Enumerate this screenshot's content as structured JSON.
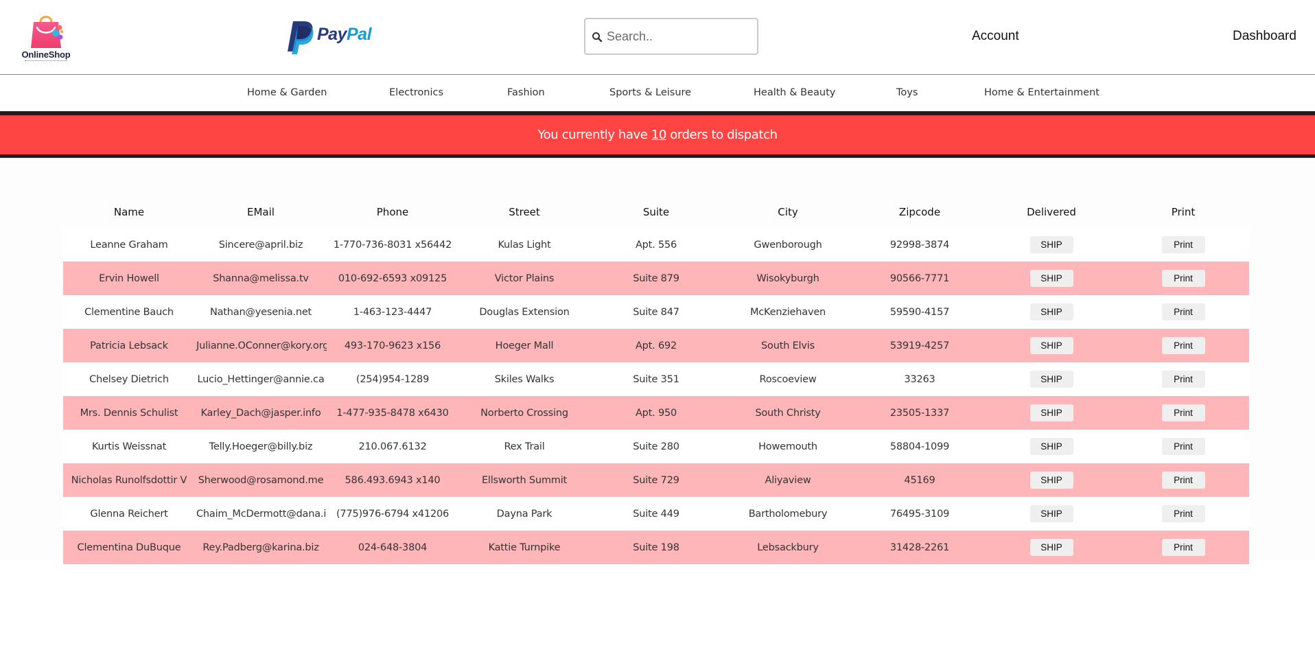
{
  "header": {
    "logo_text": "OnlineShop",
    "paypal_pay": "Pay",
    "paypal_pal": "Pal",
    "search_placeholder": "Search..",
    "account_label": "Account",
    "dashboard_label": "Dashboard"
  },
  "categories": [
    {
      "label": "Home & Garden"
    },
    {
      "label": "Electronics"
    },
    {
      "label": "Fashion"
    },
    {
      "label": "Sports & Leisure"
    },
    {
      "label": "Health & Beauty"
    },
    {
      "label": "Toys"
    },
    {
      "label": "Home & Entertainment"
    }
  ],
  "banner": {
    "prefix": "You currently have ",
    "count": "10",
    "suffix": " orders to dispatch"
  },
  "table": {
    "columns": [
      "Name",
      "EMail",
      "Phone",
      "Street",
      "Suite",
      "City",
      "Zipcode",
      "Delivered",
      "Print"
    ],
    "ship_label": "SHIP",
    "print_label": "Print",
    "rows": [
      {
        "name": "Leanne Graham",
        "email": "Sincere@april.biz",
        "phone": "1-770-736-8031 x56442",
        "street": "Kulas Light",
        "suite": "Apt. 556",
        "city": "Gwenborough",
        "zipcode": "92998-3874"
      },
      {
        "name": "Ervin Howell",
        "email": "Shanna@melissa.tv",
        "phone": "010-692-6593 x09125",
        "street": "Victor Plains",
        "suite": "Suite 879",
        "city": "Wisokyburgh",
        "zipcode": "90566-7771"
      },
      {
        "name": "Clementine Bauch",
        "email": "Nathan@yesenia.net",
        "phone": "1-463-123-4447",
        "street": "Douglas Extension",
        "suite": "Suite 847",
        "city": "McKenziehaven",
        "zipcode": "59590-4157"
      },
      {
        "name": "Patricia Lebsack",
        "email": "Julianne.OConner@kory.org",
        "phone": "493-170-9623 x156",
        "street": "Hoeger Mall",
        "suite": "Apt. 692",
        "city": "South Elvis",
        "zipcode": "53919-4257"
      },
      {
        "name": "Chelsey Dietrich",
        "email": "Lucio_Hettinger@annie.ca",
        "phone": "(254)954-1289",
        "street": "Skiles Walks",
        "suite": "Suite 351",
        "city": "Roscoeview",
        "zipcode": "33263"
      },
      {
        "name": "Mrs. Dennis Schulist",
        "email": "Karley_Dach@jasper.info",
        "phone": "1-477-935-8478 x6430",
        "street": "Norberto Crossing",
        "suite": "Apt. 950",
        "city": "South Christy",
        "zipcode": "23505-1337"
      },
      {
        "name": "Kurtis Weissnat",
        "email": "Telly.Hoeger@billy.biz",
        "phone": "210.067.6132",
        "street": "Rex Trail",
        "suite": "Suite 280",
        "city": "Howemouth",
        "zipcode": "58804-1099"
      },
      {
        "name": "Nicholas Runolfsdottir V",
        "email": "Sherwood@rosamond.me",
        "phone": "586.493.6943 x140",
        "street": "Ellsworth Summit",
        "suite": "Suite 729",
        "city": "Aliyaview",
        "zipcode": "45169"
      },
      {
        "name": "Glenna Reichert",
        "email": "Chaim_McDermott@dana.io",
        "phone": "(775)976-6794 x41206",
        "street": "Dayna Park",
        "suite": "Suite 449",
        "city": "Bartholomebury",
        "zipcode": "76495-3109"
      },
      {
        "name": "Clementina DuBuque",
        "email": "Rey.Padberg@karina.biz",
        "phone": "024-648-3804",
        "street": "Kattie Turnpike",
        "suite": "Suite 198",
        "city": "Lebsackbury",
        "zipcode": "31428-2261"
      }
    ]
  },
  "colors": {
    "banner": "#ff4444",
    "banner_border": "#1e1e1e",
    "row_alt": "#ffb6b9",
    "paypal_dark": "#253b80",
    "paypal_light": "#179bd7"
  },
  "icons": {
    "logo": "shopping-bag-icon",
    "paypal": "paypal-logo",
    "search": "search-icon"
  }
}
